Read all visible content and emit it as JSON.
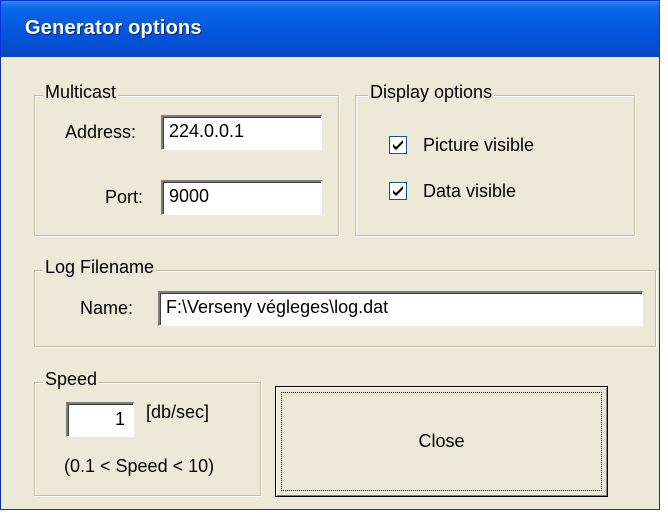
{
  "window": {
    "title": "Generator options"
  },
  "multicast": {
    "legend": "Multicast",
    "address_label": "Address:",
    "address_value": "224.0.0.1",
    "port_label": "Port:",
    "port_value": "9000"
  },
  "display": {
    "legend": "Display options",
    "picture_visible_label": "Picture visible",
    "picture_visible_checked": true,
    "data_visible_label": "Data visible",
    "data_visible_checked": true
  },
  "log": {
    "legend": "Log Filename",
    "name_label": "Name:",
    "name_value": "F:\\Verseny végleges\\log.dat"
  },
  "speed": {
    "legend": "Speed",
    "value": "1",
    "unit": "[db/sec]",
    "range_hint": "(0.1 < Speed < 10)"
  },
  "buttons": {
    "close_label": "Close"
  }
}
